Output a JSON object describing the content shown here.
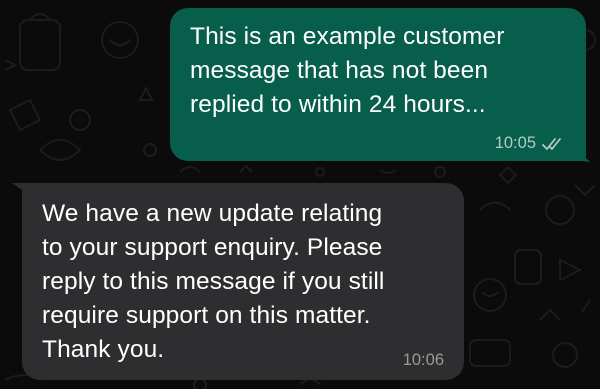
{
  "chat": {
    "messages": [
      {
        "direction": "outgoing",
        "text": "This is an example customer\nmessage that has not been\nreplied to within 24 hours...",
        "time": "10:05",
        "status_icon": "double-check-icon"
      },
      {
        "direction": "incoming",
        "text": "We have a new update relating\nto your support enquiry. Please\nreply to this message if you still\nrequire support on this matter.\nThank you.",
        "time": "10:06"
      }
    ]
  },
  "colors": {
    "background": "#0b0b0b",
    "outgoing_bubble": "#075e4a",
    "incoming_bubble": "#2e2e31",
    "message_text": "#ffffff"
  }
}
